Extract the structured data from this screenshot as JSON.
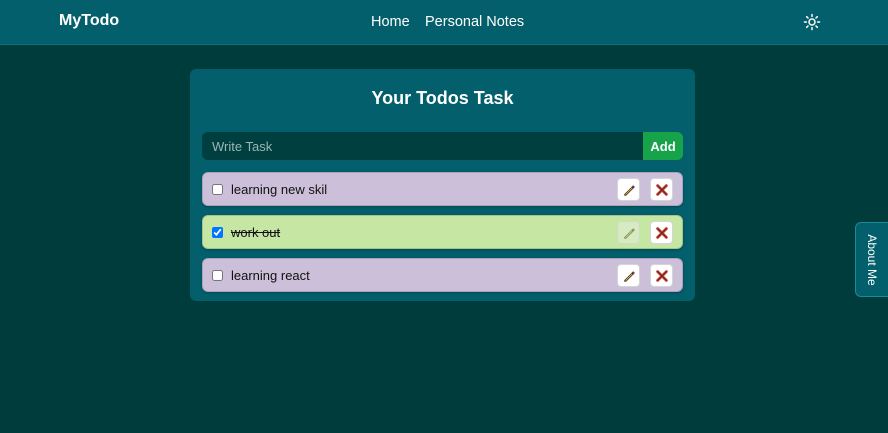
{
  "navbar": {
    "brand": "MyTodo",
    "links": [
      "Home",
      "Personal Notes"
    ],
    "theme_icon": "sun-icon"
  },
  "main": {
    "title": "Your Todos Task",
    "input_placeholder": "Write Task",
    "input_value": "",
    "add_label": "Add",
    "todos": [
      {
        "text": "learning new skil",
        "completed": false
      },
      {
        "text": "work out",
        "completed": true
      },
      {
        "text": "learning react",
        "completed": false
      }
    ]
  },
  "side_tab": {
    "label": "About Me"
  },
  "colors": {
    "background": "#003c3c",
    "navbar": "#035f6b",
    "card": "#035f6b",
    "pending_item": "#ccbfd9",
    "completed_item": "#c6e7a4",
    "add_button": "#16a34a",
    "delete_icon": "#c0392b"
  }
}
